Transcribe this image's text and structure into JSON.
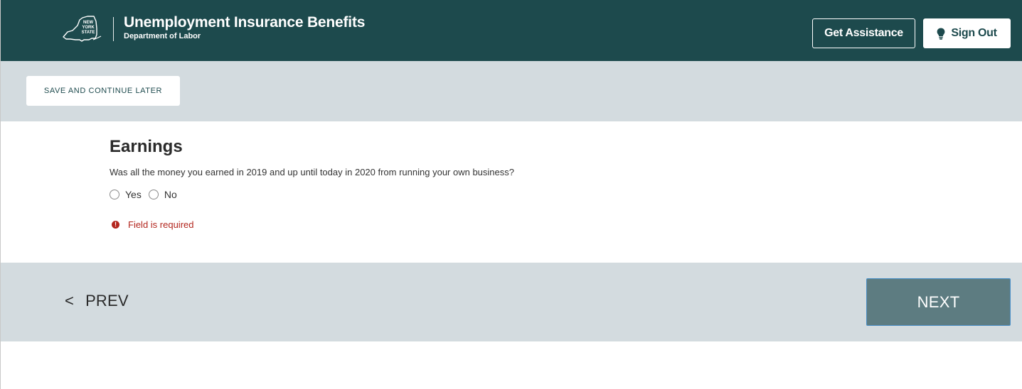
{
  "header": {
    "logo_icon": "new-york-state-logo",
    "logo_text": "NEW YORK STATE",
    "title": "Unemployment Insurance Benefits",
    "subtitle": "Department of Labor",
    "get_assistance_label": "Get Assistance",
    "sign_out_label": "Sign Out",
    "sign_out_icon": "lightbulb-icon"
  },
  "savebar": {
    "save_label": "SAVE AND CONTINUE LATER"
  },
  "form": {
    "section_title": "Earnings",
    "question": "Was all the money you earned in 2019 and up until today in 2020 from running your own business?",
    "options": [
      {
        "label": "Yes",
        "selected": false
      },
      {
        "label": "No",
        "selected": false
      }
    ],
    "error_text": "Field is required",
    "error_icon": "alert-icon"
  },
  "nav": {
    "prev_chevron": "<",
    "prev_label": "PREV",
    "next_label": "NEXT"
  },
  "colors": {
    "header_bg": "#1d4a4d",
    "bar_bg": "#d3dbdf",
    "next_bg": "#5d7c81",
    "error": "#b3261e"
  }
}
